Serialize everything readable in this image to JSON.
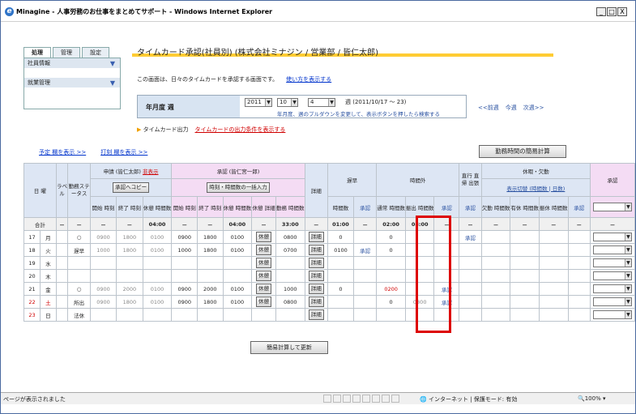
{
  "window": {
    "title": "Minagine - 人事労務のお仕事をまとめてサポート - Windows Internet Explorer",
    "min": "_",
    "max": "□",
    "close": "X"
  },
  "sidebar": {
    "tabs": [
      "処理",
      "管理",
      "設定"
    ],
    "items": [
      "社員情報",
      "就業管理"
    ]
  },
  "heading": "タイムカード承認(社員別) (株式会社ミナジン / 営業部 / 皆仁太郎)",
  "description": "この画面は、日々のタイムカードを承認する画面です。",
  "how_to_link": "使い方を表示する",
  "year_week": {
    "label": "年月度 週",
    "year": "2011",
    "month": "10",
    "week": "4",
    "week_text": "週 (2011/10/17 ～ 23)",
    "note": "年月度、週のプルダウンを変更して、表示ボタンを押したら検索する"
  },
  "nav": {
    "prev": "<<前週",
    "this": "今週",
    "next": "次週>>"
  },
  "output": {
    "label": "タイムカード出力",
    "link": "タイムカードの出力条件を表示する"
  },
  "show_links": {
    "plan": "予定 欄を表示 >>",
    "stamp": "打刻 欄を表示 >>"
  },
  "simple_calc_btn": "勤務時間の簡易計算",
  "update_btn": "簡易計算して更新",
  "table": {
    "h_day": "日",
    "h_dow": "曜",
    "h_label": "ラベル",
    "h_status": "勤務ステータス",
    "h_request": "申請 (皆仁太郎)",
    "h_hide": "非表示",
    "h_copy": "承認へコピー",
    "h_approve": "承認 (皆仁宮一郎)",
    "h_bulk": "時刻・時間数の一括入力",
    "h_detail": "詳細",
    "h_late": "遅早",
    "h_overtime": "時間外",
    "h_direct": "直行 直帰 出張",
    "h_leave": "休暇・欠勤",
    "h_toggle": "表示切替 (時間数 | 日数)",
    "h_approval": "承認",
    "sub": [
      "開始 時刻",
      "終了 時刻",
      "休憩 時間数",
      "開始 時刻",
      "終了 時刻",
      "休憩 時間数",
      "休憩 詳細",
      "勤務 時間数",
      "時間数",
      "承認",
      "通常 時間数",
      "振出 時間数",
      "承認",
      "承認",
      "欠勤 時間数",
      "有休 時間数",
      "振休 時間数",
      "承認"
    ],
    "total_label": "合計",
    "total": [
      "－",
      "－",
      "－",
      "－",
      "04:00",
      "－",
      "－",
      "04:00",
      "－",
      "33:00",
      "－",
      "01:00",
      "－",
      "02:00",
      "08:00",
      "－",
      "－",
      "－",
      "－",
      "－",
      "－",
      "－"
    ],
    "rows": [
      {
        "day": "17",
        "dow": "月",
        "label": "",
        "status": "○",
        "rs": "0900",
        "re": "1800",
        "rb": "0100",
        "as": "0900",
        "ae": "1800",
        "ab": "0100",
        "bd": "休憩",
        "work": "0800",
        "det": "詳細",
        "late": "0",
        "lap": "",
        "ot": "0",
        "fr": "",
        "oap": "",
        "dir": "承認"
      },
      {
        "day": "18",
        "dow": "火",
        "label": "",
        "status": "遅早",
        "rs": "1000",
        "re": "1800",
        "rb": "0100",
        "as": "1000",
        "ae": "1800",
        "ab": "0100",
        "bd": "休憩",
        "work": "0700",
        "det": "詳細",
        "late": "0100",
        "lap": "承認",
        "ot": "0",
        "fr": "",
        "oap": "",
        "dir": ""
      },
      {
        "day": "19",
        "dow": "水",
        "label": "",
        "status": "",
        "rs": "",
        "re": "",
        "rb": "",
        "as": "",
        "ae": "",
        "ab": "",
        "bd": "休憩",
        "work": "",
        "det": "詳細",
        "late": "",
        "lap": "",
        "ot": "",
        "fr": "",
        "oap": "",
        "dir": ""
      },
      {
        "day": "20",
        "dow": "木",
        "label": "",
        "status": "",
        "rs": "",
        "re": "",
        "rb": "",
        "as": "",
        "ae": "",
        "ab": "",
        "bd": "休憩",
        "work": "",
        "det": "詳細",
        "late": "",
        "lap": "",
        "ot": "",
        "fr": "",
        "oap": "",
        "dir": ""
      },
      {
        "day": "21",
        "dow": "金",
        "label": "",
        "status": "○",
        "rs": "0900",
        "re": "2000",
        "rb": "0100",
        "as": "0900",
        "ae": "2000",
        "ab": "0100",
        "bd": "休憩",
        "work": "1000",
        "det": "詳細",
        "late": "0",
        "lap": "",
        "ot": "0200",
        "fr": "",
        "oap": "承認",
        "dir": ""
      },
      {
        "day": "22",
        "dow": "土",
        "label": "",
        "status": "所出",
        "rs": "0900",
        "re": "1800",
        "rb": "0100",
        "as": "0900",
        "ae": "1800",
        "ab": "0100",
        "bd": "休憩",
        "work": "0800",
        "det": "詳細",
        "late": "",
        "lap": "",
        "ot": "0",
        "fr": "0800",
        "oap": "承認",
        "dir": ""
      },
      {
        "day": "23",
        "dow": "日",
        "label": "",
        "status": "法休",
        "rs": "",
        "re": "",
        "rb": "",
        "as": "",
        "ae": "",
        "ab": "",
        "bd": "",
        "work": "",
        "det": "詳細",
        "late": "",
        "lap": "",
        "ot": "",
        "fr": "",
        "oap": "",
        "dir": ""
      }
    ]
  },
  "status": {
    "left": "ページが表示されました",
    "zone": "インターネット | 保護モード: 有効",
    "zoom": "100%"
  },
  "colors": {
    "accent": "#ffcc33",
    "highlight": "#dd0000",
    "header_pink": "#f4dcf4",
    "header_blue": "#dde6f4"
  }
}
